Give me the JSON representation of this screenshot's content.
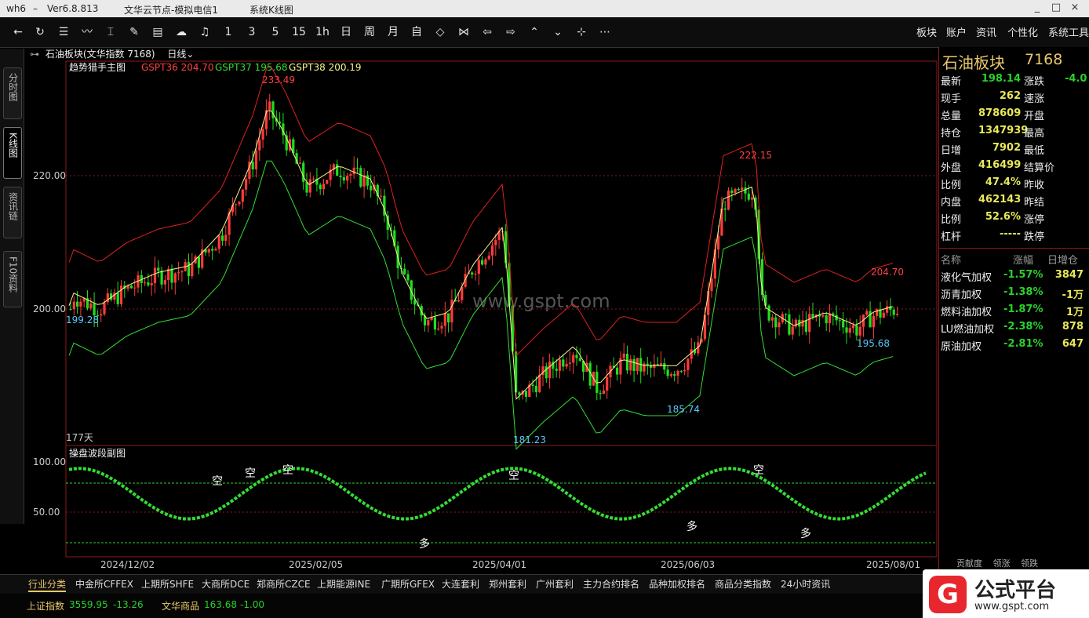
{
  "titlebar": {
    "app": "wh6",
    "dash": "–",
    "version": "Ver6.8.813",
    "server": "文华云节点-模拟电信1",
    "context": "系统K线图",
    "buttons": [
      "_",
      "□",
      "×"
    ]
  },
  "toolbar": {
    "back_icon": "back-arrow-icon",
    "items": [
      "1",
      "3",
      "5",
      "15",
      "1h",
      "日",
      "周",
      "月"
    ],
    "right_menu": [
      "板块",
      "账户",
      "资讯",
      "个性化",
      "系统工具"
    ]
  },
  "left_tabs": [
    "分时图",
    "K线图",
    "资讯链",
    "F10资料"
  ],
  "chart": {
    "symbol_header": "石油板块(文华指数 7168)",
    "period": "日线",
    "main_indicator": "趋势猎手主图",
    "gspt36": "GSPT36 204.70",
    "gspt37": "GSPT37 195.68",
    "gspt38": "GSPT38 200.19",
    "watermark": "www.gspt.com",
    "days": "177天",
    "y_ticks": [
      "220.00",
      "200.00"
    ],
    "labels": {
      "hi1": "233.49",
      "hi2": "222.15",
      "r1": "204.70",
      "lo1": "199.28",
      "lo2": "195.68",
      "lo3": "185.74",
      "lo4": "181.23"
    },
    "sub_indicator": "操盘波段副图",
    "sub_y_ticks": [
      "100.00",
      "50.00"
    ],
    "sub_marks": [
      "空",
      "空",
      "空",
      "空",
      "空",
      "多",
      "多",
      "多"
    ],
    "x_ticks": [
      "2024/12/02",
      "2025/02/05",
      "2025/04/01",
      "2025/06/03",
      "2025/08/01"
    ],
    "colors": {
      "up": "#ff3b3b",
      "down": "#1ee01e",
      "yellow": "#f5f58c",
      "magenta": "#e040e0",
      "label_blue": "#5ac8fa"
    }
  },
  "chart_data": {
    "type": "candlestick",
    "title": "石油板块(文华指数 7168) 日线",
    "y_range": [
      178,
      238
    ],
    "points": [
      {
        "label": "high",
        "value": 233.49
      },
      {
        "label": "high",
        "value": 222.15
      },
      {
        "label": "low",
        "value": 199.28
      },
      {
        "label": "low",
        "value": 181.23
      },
      {
        "label": "low",
        "value": 185.74
      },
      {
        "label": "low",
        "value": 195.68
      },
      {
        "label": "GSPT36",
        "value": 204.7
      },
      {
        "label": "GSPT37",
        "value": 195.68
      },
      {
        "label": "GSPT38",
        "value": 200.19
      }
    ]
  },
  "quote_panel": {
    "name": "石油板块",
    "code": "7168",
    "rows": [
      {
        "l1": "最新",
        "v1": "198.14",
        "c1": "#2ad02a",
        "l2": "涨跌",
        "v2": "-4.0"
      },
      {
        "l1": "现手",
        "v1": "262",
        "c1": "#e8e85a",
        "l2": "速涨",
        "v2": ""
      },
      {
        "l1": "总量",
        "v1": "878609",
        "c1": "#e8e85a",
        "l2": "开盘",
        "v2": ""
      },
      {
        "l1": "持仓",
        "v1": "1347939",
        "c1": "#e8e85a",
        "l2": "最高",
        "v2": ""
      },
      {
        "l1": "日增",
        "v1": "7902",
        "c1": "#e8e85a",
        "l2": "最低",
        "v2": ""
      },
      {
        "l1": "外盘",
        "v1": "416499",
        "c1": "#e8e85a",
        "l2": "结算价",
        "v2": ""
      },
      {
        "l1": "比例",
        "v1": "47.4%",
        "c1": "#e8e85a",
        "l2": "昨收",
        "v2": ""
      },
      {
        "l1": "内盘",
        "v1": "462143",
        "c1": "#e8e85a",
        "l2": "昨结",
        "v2": ""
      },
      {
        "l1": "比例",
        "v1": "52.6%",
        "c1": "#e8e85a",
        "l2": "涨停",
        "v2": ""
      },
      {
        "l1": "杠杆",
        "v1": "-----",
        "c1": "#e8e85a",
        "l2": "跌停",
        "v2": ""
      }
    ],
    "list_headers": [
      "名称",
      "涨幅",
      "日增仓"
    ],
    "list": [
      {
        "name": "液化气加权",
        "pct": "-1.57%",
        "inc": "3847"
      },
      {
        "name": "沥青加权",
        "pct": "-1.38%",
        "inc": "-1万"
      },
      {
        "name": "燃料油加权",
        "pct": "-1.87%",
        "inc": "1万"
      },
      {
        "name": "LU燃油加权",
        "pct": "-2.38%",
        "inc": "878"
      },
      {
        "name": "原油加权",
        "pct": "-2.81%",
        "inc": "647"
      }
    ],
    "footer_tabs": [
      "贡献度",
      "领涨",
      "领跌"
    ]
  },
  "bottom_tabs": [
    "行业分类",
    "中金所CFFEX",
    "上期所SHFE",
    "大商所DCE",
    "郑商所CZCE",
    "上期能源INE",
    "广期所GFEX",
    "大连套利",
    "郑州套利",
    "广州套利",
    "主力合约排名",
    "品种加权排名",
    "商品分类指数",
    "24小时资讯"
  ],
  "status": {
    "idx1_name": "上证指数",
    "idx1_val": "3559.95",
    "idx1_chg": "-13.26",
    "idx2_name": "文华商品",
    "idx2_val": "163.68",
    "idx2_chg": "-1.00"
  },
  "logo": {
    "brand": "公式平台",
    "url": "www.gspt.com"
  }
}
